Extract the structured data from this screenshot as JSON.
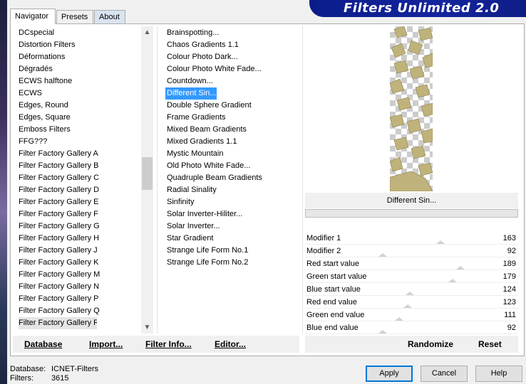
{
  "tabs": [
    "Navigator",
    "Presets",
    "About"
  ],
  "title": "Filters Unlimited 2.0",
  "categories": [
    "DCspecial",
    "Distortion Filters",
    "Déformations",
    "Dégradés",
    "ECWS halftone",
    "ECWS",
    "Edges, Round",
    "Edges, Square",
    "Emboss Filters",
    "FFG???",
    "Filter Factory Gallery A",
    "Filter Factory Gallery B",
    "Filter Factory Gallery C",
    "Filter Factory Gallery D",
    "Filter Factory Gallery E",
    "Filter Factory Gallery F",
    "Filter Factory Gallery G",
    "Filter Factory Gallery H",
    "Filter Factory Gallery J",
    "Filter Factory Gallery K",
    "Filter Factory Gallery M",
    "Filter Factory Gallery N",
    "Filter Factory Gallery P",
    "Filter Factory Gallery Q",
    "Filter Factory Gallery R"
  ],
  "selected_category_index": 24,
  "filters": [
    "Brainspotting...",
    "Chaos Gradients 1.1",
    "Colour Photo Dark...",
    "Colour Photo White Fade...",
    "Countdown...",
    "Different Sin...",
    "Double Sphere Gradient",
    "Frame Gradients",
    "Mixed Beam Gradients",
    "Mixed Gradients 1.1",
    "Mystic Mountain",
    "Old Photo White Fade...",
    "Quadruple Beam Gradients",
    "Radial Sinality",
    "Sinfinity",
    "Solar Inverter-Hiliter...",
    "Solar Inverter...",
    "Star Gradient",
    "Strange Life Form No.1",
    "Strange Life Form No.2"
  ],
  "selected_filter_index": 5,
  "preview_caption": "Different Sin...",
  "parameters": [
    {
      "name": "Modifier 1",
      "value": "163",
      "level": 0.64
    },
    {
      "name": "Modifier 2",
      "value": "92",
      "level": 0.36
    },
    {
      "name": "Red start value",
      "value": "189",
      "level": 0.74
    },
    {
      "name": "Green start value",
      "value": "179",
      "level": 0.7
    },
    {
      "name": "Blue start value",
      "value": "124",
      "level": 0.49
    },
    {
      "name": "Red end value",
      "value": "123",
      "level": 0.48
    },
    {
      "name": "Green end value",
      "value": "111",
      "level": 0.44
    },
    {
      "name": "Blue end value",
      "value": "92",
      "level": 0.36
    }
  ],
  "left_buttons": {
    "database": "Database",
    "import": "Import...",
    "filter_info": "Filter Info...",
    "editor": "Editor..."
  },
  "right_buttons": {
    "randomize": "Randomize",
    "reset": "Reset"
  },
  "status": {
    "database_label": "Database:",
    "database_value": "ICNET-Filters",
    "filters_label": "Filters:",
    "filters_value": "3615"
  },
  "dialog_buttons": {
    "apply": "Apply",
    "cancel": "Cancel",
    "help": "Help"
  },
  "colors": {
    "banner": "#0b1c8a",
    "selection": "#3399ff",
    "primary_button_border": "#0078d7"
  }
}
